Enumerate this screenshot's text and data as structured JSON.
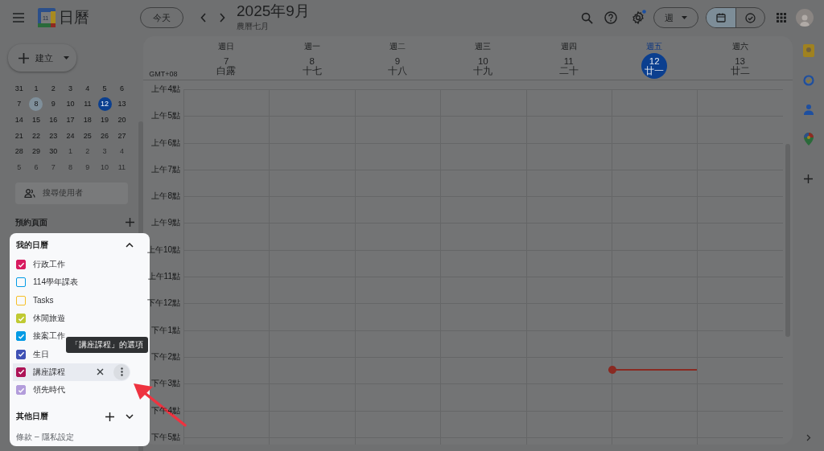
{
  "header": {
    "app_title": "日曆",
    "logo_day": "11",
    "today_button": "今天",
    "month_title": "2025年9月",
    "lunar_month": "農曆七月",
    "view_button": "週",
    "settings_dot": true,
    "view_toggle": [
      {
        "kind": "calendar",
        "selected": true
      },
      {
        "kind": "tasks",
        "selected": false
      }
    ]
  },
  "create_button": "建立",
  "mini_calendar": {
    "weeks": [
      [
        {
          "day": "31",
          "kind": "plain"
        },
        {
          "day": "1",
          "kind": "plain"
        },
        {
          "day": "2",
          "kind": "plain"
        },
        {
          "day": "3",
          "kind": "plain"
        },
        {
          "day": "4",
          "kind": "plain"
        },
        {
          "day": "5",
          "kind": "plain"
        },
        {
          "day": "6",
          "kind": "plain"
        }
      ],
      [
        {
          "day": "7",
          "kind": "plain"
        },
        {
          "day": "8",
          "kind": "selected"
        },
        {
          "day": "9",
          "kind": "plain"
        },
        {
          "day": "10",
          "kind": "plain"
        },
        {
          "day": "11",
          "kind": "plain"
        },
        {
          "day": "12",
          "kind": "today"
        },
        {
          "day": "13",
          "kind": "plain"
        }
      ],
      [
        {
          "day": "14",
          "kind": "plain"
        },
        {
          "day": "15",
          "kind": "plain"
        },
        {
          "day": "16",
          "kind": "plain"
        },
        {
          "day": "17",
          "kind": "plain"
        },
        {
          "day": "18",
          "kind": "plain"
        },
        {
          "day": "19",
          "kind": "plain"
        },
        {
          "day": "20",
          "kind": "plain"
        }
      ],
      [
        {
          "day": "21",
          "kind": "plain"
        },
        {
          "day": "22",
          "kind": "plain"
        },
        {
          "day": "23",
          "kind": "plain"
        },
        {
          "day": "24",
          "kind": "plain"
        },
        {
          "day": "25",
          "kind": "plain"
        },
        {
          "day": "26",
          "kind": "plain"
        },
        {
          "day": "27",
          "kind": "plain"
        }
      ],
      [
        {
          "day": "28",
          "kind": "plain"
        },
        {
          "day": "29",
          "kind": "plain"
        },
        {
          "day": "30",
          "kind": "plain"
        },
        {
          "day": "1",
          "kind": "muted"
        },
        {
          "day": "2",
          "kind": "muted"
        },
        {
          "day": "3",
          "kind": "muted"
        },
        {
          "day": "4",
          "kind": "muted"
        }
      ],
      [
        {
          "day": "5",
          "kind": "muted"
        },
        {
          "day": "6",
          "kind": "muted"
        },
        {
          "day": "7",
          "kind": "muted"
        },
        {
          "day": "8",
          "kind": "muted"
        },
        {
          "day": "9",
          "kind": "muted"
        },
        {
          "day": "10",
          "kind": "muted"
        },
        {
          "day": "11",
          "kind": "muted"
        }
      ]
    ]
  },
  "people_search": {
    "placeholder": "搜尋使用者"
  },
  "booking_pages": {
    "title": "預約頁面"
  },
  "my_calendars": {
    "title": "我的日曆",
    "expanded": true,
    "items": [
      {
        "name": "行政工作",
        "color": "#d81b60",
        "checked": true,
        "hovered": false
      },
      {
        "name": "114學年課表",
        "color": "#039be5",
        "checked": false,
        "hovered": false
      },
      {
        "name": "Tasks",
        "color": "#f6bf26",
        "checked": false,
        "hovered": false
      },
      {
        "name": "休閒旅遊",
        "color": "#c0ca33",
        "checked": true,
        "hovered": false
      },
      {
        "name": "接案工作",
        "color": "#039be5",
        "checked": true,
        "hovered": false
      },
      {
        "name": "生日",
        "color": "#3f51b5",
        "checked": true,
        "hovered": false
      },
      {
        "name": "講座課程",
        "color": "#ad1457",
        "checked": true,
        "hovered": true,
        "tooltip": "「講座課程」的選項"
      },
      {
        "name": "領先時代",
        "color": "#b39ddb",
        "checked": true,
        "hovered": false
      }
    ]
  },
  "other_calendars": {
    "title": "其他日曆",
    "expanded": false
  },
  "footer": {
    "terms": "條款",
    "separator": "–",
    "privacy": "隱私設定"
  },
  "week": {
    "timezone": "GMT+08",
    "days": [
      {
        "weekday": "週日",
        "date": "7",
        "lunar": "白露",
        "today": false
      },
      {
        "weekday": "週一",
        "date": "8",
        "lunar": "十七",
        "today": false
      },
      {
        "weekday": "週二",
        "date": "9",
        "lunar": "十八",
        "today": false
      },
      {
        "weekday": "週三",
        "date": "10",
        "lunar": "十九",
        "today": false
      },
      {
        "weekday": "週四",
        "date": "11",
        "lunar": "二十",
        "today": false
      },
      {
        "weekday": "週五",
        "date": "12",
        "lunar": "廿一",
        "today": true
      },
      {
        "weekday": "週六",
        "date": "13",
        "lunar": "廿二",
        "today": false
      }
    ],
    "hours": [
      "上午4點",
      "上午5點",
      "上午6點",
      "上午7點",
      "上午8點",
      "上午9點",
      "上午10點",
      "上午11點",
      "下午12點",
      "下午1點",
      "下午2點",
      "下午3點",
      "下午4點",
      "下午5點"
    ]
  }
}
